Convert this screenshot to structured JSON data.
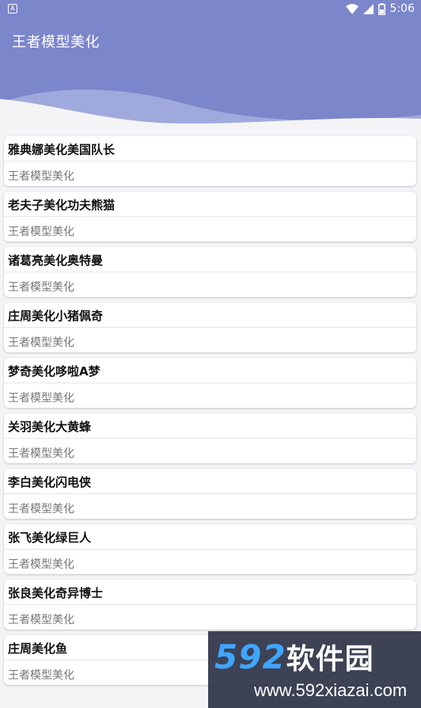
{
  "statusbar": {
    "time": "5:06",
    "notification_icon": "android-notification-icon",
    "left_glyph": "A"
  },
  "header": {
    "title": "王者模型美化",
    "color": "#7b86cb"
  },
  "items": [
    {
      "title": "雅典娜美化美国队长",
      "subtitle": "王者模型美化"
    },
    {
      "title": "老夫子美化功夫熊猫",
      "subtitle": "王者模型美化"
    },
    {
      "title": "诸葛亮美化奥特曼",
      "subtitle": "王者模型美化"
    },
    {
      "title": "庄周美化小猪佩奇",
      "subtitle": "王者模型美化"
    },
    {
      "title": "梦奇美化哆啦A梦",
      "subtitle": "王者模型美化"
    },
    {
      "title": "关羽美化大黄蜂",
      "subtitle": "王者模型美化"
    },
    {
      "title": "李白美化闪电侠",
      "subtitle": "王者模型美化"
    },
    {
      "title": "张飞美化绿巨人",
      "subtitle": "王者模型美化"
    },
    {
      "title": "张良美化奇异博士",
      "subtitle": "王者模型美化"
    },
    {
      "title": "庄周美化鱼",
      "subtitle": "王者模型美化"
    }
  ],
  "watermark": {
    "brand_number": "592",
    "brand_text": "软件园",
    "url": "www.592xiazai.com"
  }
}
